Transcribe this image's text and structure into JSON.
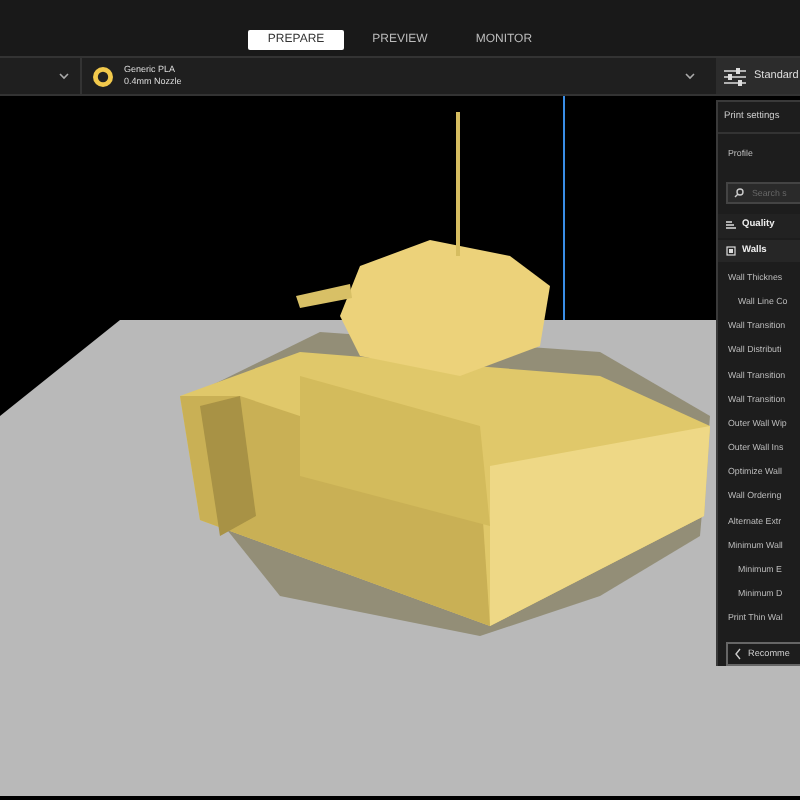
{
  "stage_tabs": [
    {
      "label": "PREPARE",
      "selected": true
    },
    {
      "label": "PREVIEW",
      "selected": false
    },
    {
      "label": "MONITOR",
      "selected": false
    }
  ],
  "material": {
    "name": "Generic PLA",
    "nozzle": "0.4mm Nozzle"
  },
  "profile_button": {
    "label": "Standard"
  },
  "print_settings": {
    "title": "Print settings",
    "profile_label": "Profile",
    "search": {
      "placeholder": "Search s"
    },
    "categories": [
      {
        "label": "Quality",
        "expanded": false
      },
      {
        "label": "Walls",
        "expanded": true
      }
    ],
    "settings": [
      {
        "label": "Wall Thicknes",
        "children": [
          {
            "label": "Wall Line Co"
          }
        ]
      },
      {
        "label": "Wall Transition"
      },
      {
        "label": "Wall Distributi"
      },
      {
        "label": "Wall Transition"
      },
      {
        "label": "Wall Transition"
      },
      {
        "label": "Outer Wall Wip"
      },
      {
        "label": "Outer Wall Ins"
      },
      {
        "label": "Optimize Wall"
      },
      {
        "label": "Wall Ordering"
      },
      {
        "label": "Alternate Extr"
      },
      {
        "label": "Minimum Wall",
        "children": [
          {
            "label": "Minimum E"
          },
          {
            "label": "Minimum D"
          }
        ]
      },
      {
        "label": "Print Thin Wal"
      }
    ],
    "recommended_button": {
      "label": "Recomme"
    }
  }
}
